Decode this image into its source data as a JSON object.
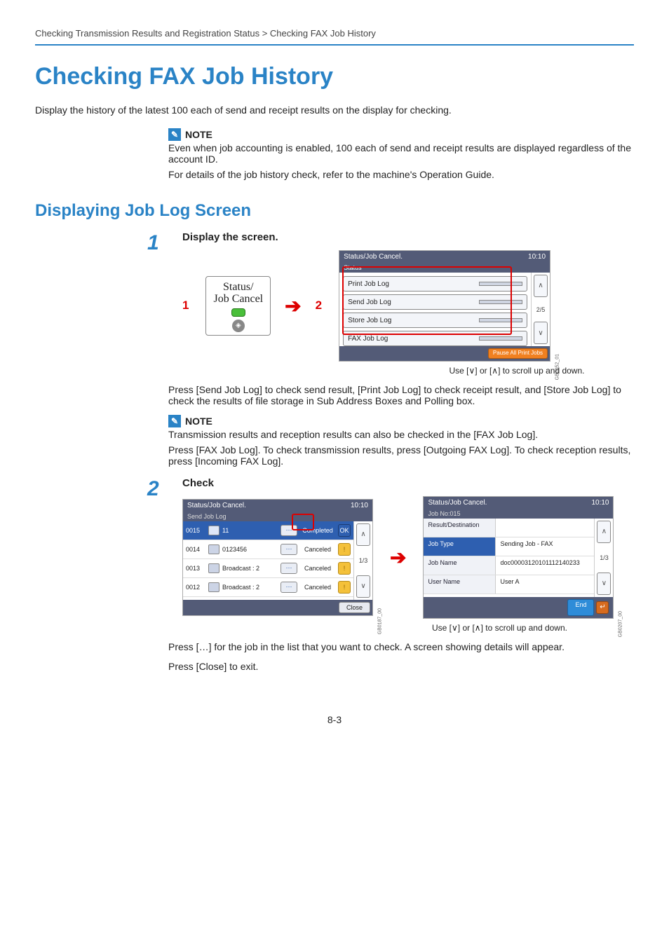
{
  "breadcrumb": "Checking Transmission Results and Registration Status > Checking FAX Job History",
  "title": "Checking FAX Job History",
  "intro": "Display the history of the latest 100 each of send and receipt results on the display for checking.",
  "note1": {
    "label": "NOTE",
    "line1": "Even when job accounting is enabled, 100 each of send and receipt results are displayed regardless of the account ID.",
    "line2": "For details of the job history check, refer to the machine's Operation Guide."
  },
  "sub_title": "Displaying Job Log Screen",
  "step1": {
    "num": "1",
    "title": "Display the screen.",
    "sub1": "1",
    "sub2": "2",
    "key_line1": "Status/",
    "key_line2": "Job Cancel",
    "panel": {
      "title": "Status/Job Cancel.",
      "time": "10:10",
      "status": "Status",
      "items": [
        "Print Job Log",
        "Send Job Log",
        "Store Job Log",
        "FAX Job Log"
      ],
      "page": "2/5",
      "pause": "Pause All Print Jobs",
      "gb": "GB0052_01"
    },
    "hint": "Use [∨] or [∧] to scroll up and down."
  },
  "para1": "Press [Send Job Log] to check send result, [Print Job Log] to check receipt result, and [Store Job Log] to check the results of file storage in Sub Address Boxes and Polling box.",
  "note2": {
    "label": "NOTE",
    "line1": "Transmission results and reception results can also be checked in the [FAX Job Log].",
    "line2": "Press [FAX Job Log]. To check transmission results, press [Outgoing FAX Log]. To check reception results, press [Incoming FAX Log]."
  },
  "step2": {
    "num": "2",
    "title": "Check",
    "list_panel": {
      "title": "Status/Job Cancel.",
      "time": "10:10",
      "sub": "Send Job Log",
      "rows": [
        {
          "id": "0015",
          "dest": "11",
          "status": "Completed",
          "icon": "OK",
          "sel": true
        },
        {
          "id": "0014",
          "dest": "0123456",
          "status": "Canceled",
          "icon": "!",
          "sel": false
        },
        {
          "id": "0013",
          "dest": "Broadcast : 2",
          "status": "Canceled",
          "icon": "!",
          "sel": false
        },
        {
          "id": "0012",
          "dest": "Broadcast : 2",
          "status": "Canceled",
          "icon": "!",
          "sel": false
        }
      ],
      "page": "1/3",
      "close": "Close",
      "gb": "GB0187_00"
    },
    "detail_panel": {
      "title": "Status/Job Cancel.",
      "time": "10:10",
      "sub": "Job No:015",
      "rows": [
        {
          "label": "Result/Destination",
          "value": "",
          "sel": false
        },
        {
          "label": "Job Type",
          "value": "Sending Job - FAX",
          "sel": true
        },
        {
          "label": "Job Name",
          "value": "doc00003120101112140233",
          "sel": false
        },
        {
          "label": "User Name",
          "value": "User A",
          "sel": false
        }
      ],
      "page": "1/3",
      "end": "End",
      "gb": "GB0207_00"
    },
    "hint": "Use [∨] or [∧] to scroll up and down."
  },
  "para2": "Press […] for the job in the list that you want to check. A screen showing details will appear.",
  "para3": "Press [Close] to exit.",
  "page_num": "8-3"
}
